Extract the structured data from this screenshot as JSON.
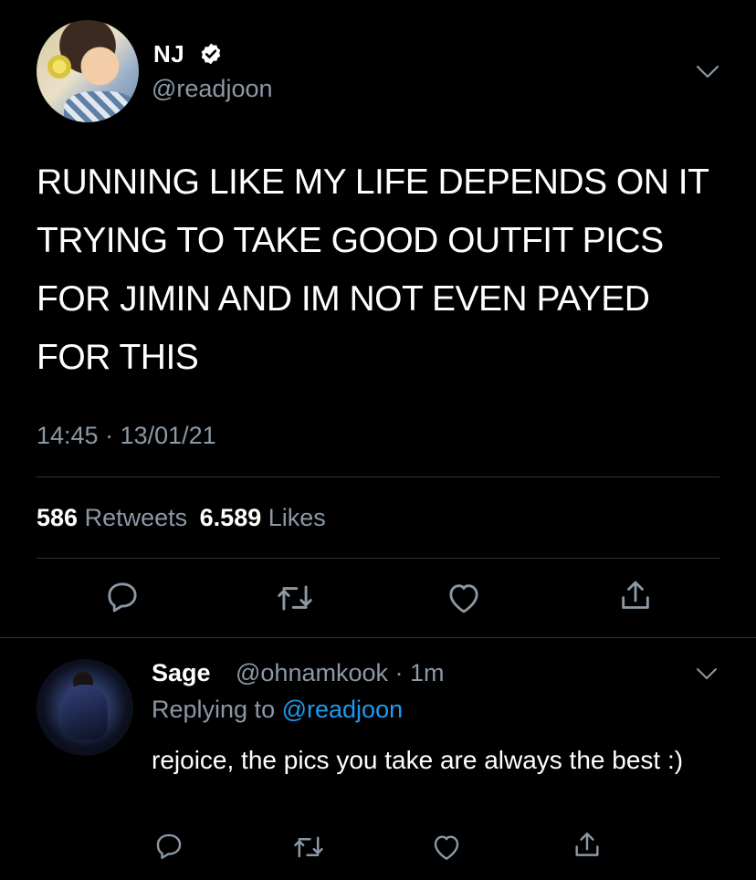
{
  "tweet": {
    "author_name": "NJ",
    "author_handle": "@readjoon",
    "verified_icon": "verified-badge-icon",
    "text": "RUNNING LIKE MY LIFE DEPENDS ON IT TRYING TO TAKE GOOD OUTFIT PICS FOR JIMIN AND IM NOT EVEN PAYED FOR THIS",
    "time": "14:45 · 13/01/21",
    "retweets_count": "586",
    "retweets_label": "Retweets",
    "likes_count": "6.589",
    "likes_label": "Likes",
    "actions": [
      "reply-icon",
      "retweet-icon",
      "like-icon",
      "share-icon"
    ]
  },
  "reply": {
    "author_name": "Sage",
    "author_handle_time": "@ohnamkook · 1m",
    "replying_prefix": "Replying to",
    "replying_mention": "@readjoon",
    "text": "rejoice, the pics you take are always the best :)",
    "actions": [
      "reply-icon",
      "retweet-icon",
      "like-icon",
      "share-icon"
    ]
  },
  "colors": {
    "background": "#000000",
    "secondary_text": "#8b98a5",
    "link": "#1d9bf0",
    "divider": "#2f3336"
  }
}
